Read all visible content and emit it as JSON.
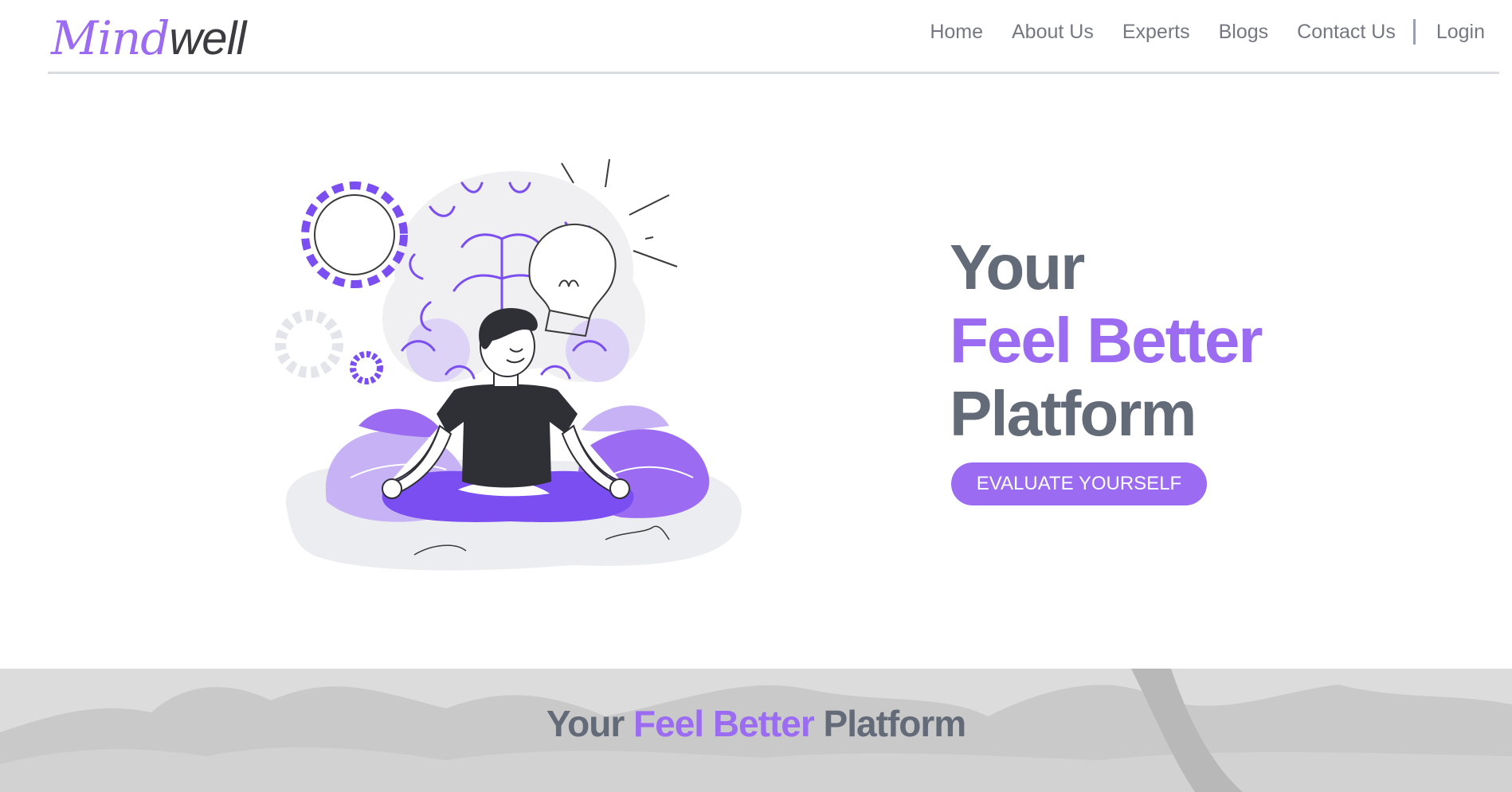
{
  "logo": {
    "script_part": "Mind",
    "plain_part": "well"
  },
  "nav": {
    "items": [
      "Home",
      "About Us",
      "Experts",
      "Blogs",
      "Contact Us"
    ],
    "login": "Login"
  },
  "hero": {
    "line1": "Your",
    "line2": "Feel Better",
    "line3": "Platform",
    "cta_label": "EVALUATE YOURSELF"
  },
  "section": {
    "title_part1": "Your",
    "title_part2": "Feel Better",
    "title_part3": "Platform"
  },
  "colors": {
    "accent": "#9b6bf2",
    "accent_dark": "#7a4ef0",
    "heading_gray": "#636b78",
    "nav_text": "#757880",
    "band_bg": "#dcdcdc"
  },
  "icons": [
    "gear-icon",
    "lightbulb-icon",
    "brain-icon",
    "meditating-person-icon"
  ]
}
